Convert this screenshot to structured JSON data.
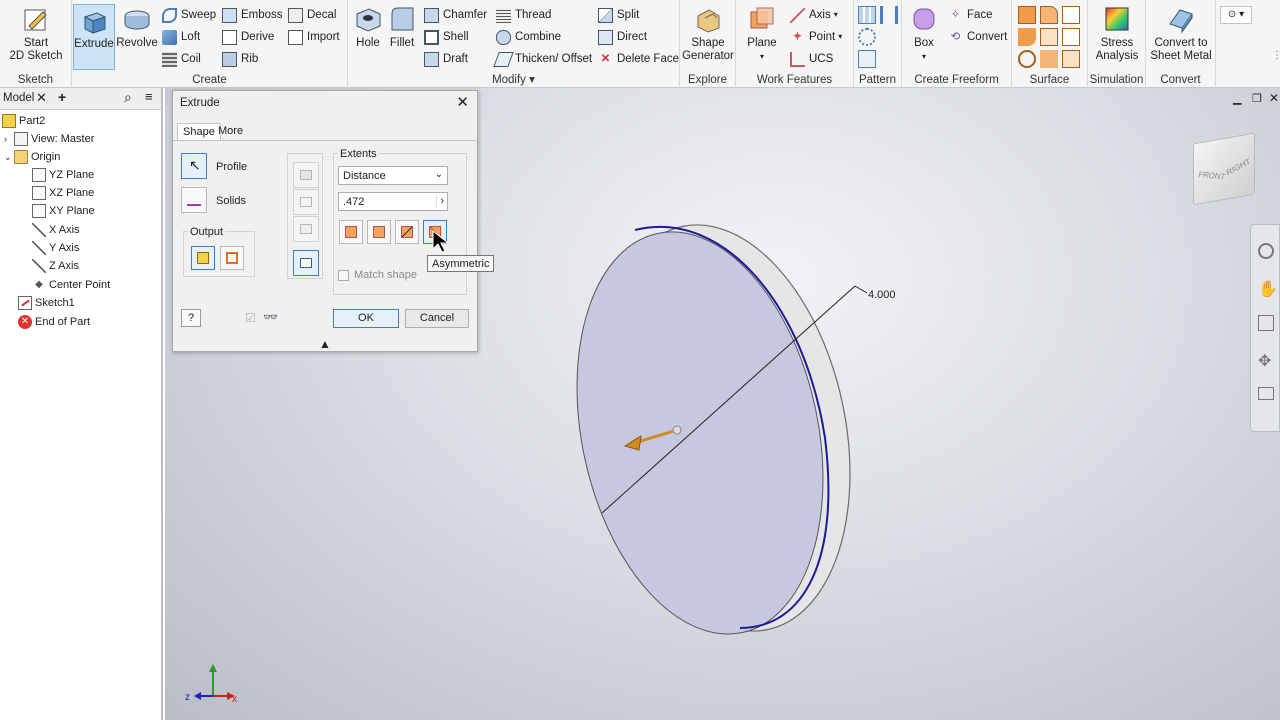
{
  "ribbon": {
    "sketch": {
      "start_label": "Start\n2D Sketch",
      "group": "Sketch"
    },
    "create": {
      "extrude": "Extrude",
      "revolve": "Revolve",
      "sweep": "Sweep",
      "loft": "Loft",
      "coil": "Coil",
      "emboss": "Emboss",
      "derive": "Derive",
      "rib": "Rib",
      "decal": "Decal",
      "import": "Import",
      "group": "Create"
    },
    "modify": {
      "hole": "Hole",
      "fillet": "Fillet",
      "chamfer": "Chamfer",
      "shell": "Shell",
      "draft": "Draft",
      "thread": "Thread",
      "combine": "Combine",
      "thicken": "Thicken/ Offset",
      "split": "Split",
      "direct": "Direct",
      "delete_face": "Delete Face",
      "group": "Modify"
    },
    "explore": {
      "shape_generator": "Shape\nGenerator",
      "group": "Explore"
    },
    "work": {
      "plane": "Plane",
      "axis": "Axis",
      "point": "Point",
      "ucs": "UCS",
      "group": "Work Features"
    },
    "pattern": {
      "group": "Pattern"
    },
    "freeform": {
      "box": "Box",
      "face": "Face",
      "convert": "Convert",
      "group": "Create Freeform"
    },
    "surface": {
      "group": "Surface"
    },
    "simulation": {
      "stress": "Stress\nAnalysis",
      "group": "Simulation"
    },
    "convert": {
      "sheet_metal": "Convert to\nSheet Metal",
      "group": "Convert"
    }
  },
  "browser": {
    "tab_label": "Model",
    "tree": [
      {
        "label": "Part2",
        "icon": "part-icon"
      },
      {
        "label": "View: Master",
        "icon": "view-icon"
      },
      {
        "label": "Origin",
        "icon": "folder-icon"
      },
      {
        "label": "YZ Plane",
        "icon": "plane-icon"
      },
      {
        "label": "XZ Plane",
        "icon": "plane-icon"
      },
      {
        "label": "XY Plane",
        "icon": "plane-icon"
      },
      {
        "label": "X Axis",
        "icon": "axis-icon"
      },
      {
        "label": "Y Axis",
        "icon": "axis-icon"
      },
      {
        "label": "Z Axis",
        "icon": "axis-icon"
      },
      {
        "label": "Center Point",
        "icon": "point-icon"
      },
      {
        "label": "Sketch1",
        "icon": "sketch-icon"
      },
      {
        "label": "End of Part",
        "icon": "end-of-part-icon"
      }
    ]
  },
  "dialog": {
    "title": "Extrude",
    "tabs": [
      "Shape",
      "More"
    ],
    "profile": "Profile",
    "solids": "Solids",
    "output": "Output",
    "extents": "Extents",
    "distance_option": "Distance",
    "distance_value": ".472",
    "match_shape": "Match shape",
    "tooltip": "Asymmetric",
    "ok": "OK",
    "cancel": "Cancel"
  },
  "viewport": {
    "dimension": "4.000",
    "viewcube_front": "FRONT",
    "viewcube_right": "RIGHT",
    "triad_x": "x",
    "triad_z": "z"
  },
  "colors": {
    "accent_blue": "#1f6fbf",
    "disc_face": "#c5c8de",
    "disc_edge": "#1a1a9a",
    "arrow": "#d38a1e"
  }
}
